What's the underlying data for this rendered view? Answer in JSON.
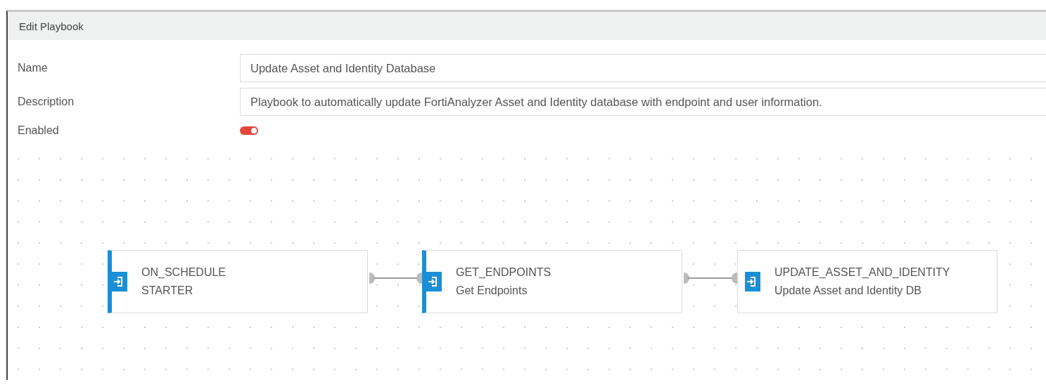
{
  "panel": {
    "title": "Edit Playbook"
  },
  "form": {
    "name_label": "Name",
    "name_value": "Update Asset and Identity Database",
    "description_label": "Description",
    "description_value": "Playbook to automatically update FortiAnalyzer Asset and Identity database with endpoint and user information.",
    "enabled_label": "Enabled",
    "enabled": true
  },
  "nodes": [
    {
      "title": "ON_SCHEDULE",
      "subtitle": "STARTER",
      "accented": true
    },
    {
      "title": "GET_ENDPOINTS",
      "subtitle": "Get Endpoints",
      "accented": true
    },
    {
      "title": "UPDATE_ASSET_AND_IDENTITY",
      "subtitle": "Update Asset and Identity DB",
      "accented": false
    }
  ]
}
